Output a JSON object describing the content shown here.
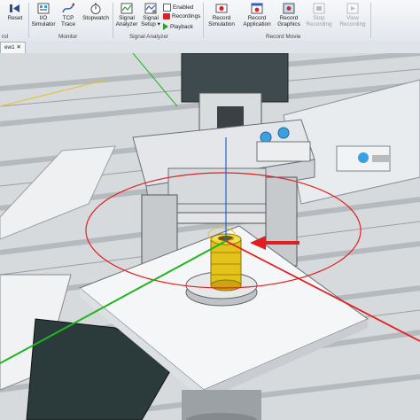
{
  "ribbon": {
    "reset": "Reset",
    "io_simulator": "I/O\nSimulator",
    "tcp_trace": "TCP\nTrace",
    "stopwatch": "Stopwatch",
    "signal_analyzer": "Signal\nAnalyzer",
    "signal_setup": "Signal\nSetup ▾",
    "enabled": "Enabled",
    "recordings": "Recordings",
    "playback": "Playback",
    "record_simulation": "Record\nSimulation",
    "record_application": "Record\nApplication",
    "record_graphics": "Record\nGraphics",
    "stop_recording": "Stop\nRecording",
    "view_recording": "View\nRecording",
    "group_monitor": "Monitor",
    "group_signal_analyzer": "Signal Analyzer",
    "group_record_movie": "Record Movie",
    "group_left": "rol"
  },
  "document_tab": "ew1 ✕",
  "colors": {
    "accent_red": "#e02020",
    "axis_green": "#1fb51f",
    "part_yellow": "#e3c31a",
    "dark_teal": "#2b3a3a"
  }
}
